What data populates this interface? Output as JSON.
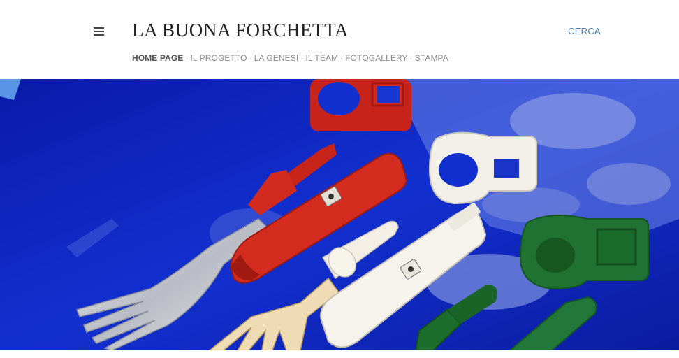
{
  "header": {
    "title": "LA BUONA FORCHETTA",
    "search_label": "CERCA",
    "menu_icon": "hamburger-menu-icon"
  },
  "nav": {
    "separator": "·",
    "items": [
      {
        "label": "HOME PAGE",
        "active": true
      },
      {
        "label": "IL PROGETTO",
        "active": false
      },
      {
        "label": "LA GENESI",
        "active": false
      },
      {
        "label": "IL TEAM",
        "active": false
      },
      {
        "label": "FOTOGALLERY",
        "active": false
      },
      {
        "label": "STAMPA",
        "active": false
      }
    ]
  },
  "colors": {
    "background_blue": "#0d1fb8",
    "red": "#d22a1e",
    "white": "#f4f2ec",
    "green": "#1c6b2c",
    "accent_link": "#4a7ab0"
  }
}
